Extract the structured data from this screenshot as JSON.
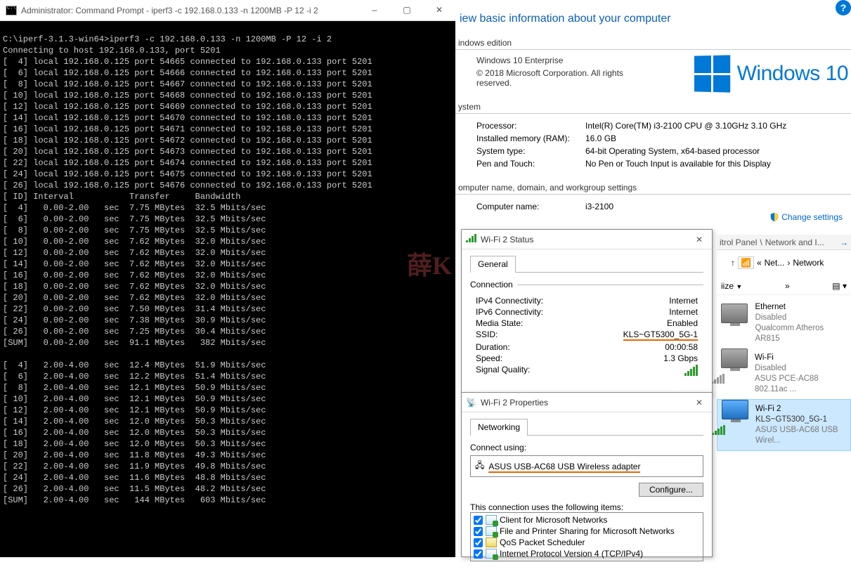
{
  "cmd": {
    "title": "Administrator: Command Prompt - iperf3  -c 192.168.0.133 -n 1200MB -P 12 -i 2",
    "prompt_prefix": "C:\\iperf-3.1.3-win64>",
    "command": "iperf3 -c 192.168.0.133 -n 1200MB -P 12 -i 2",
    "connecting": "Connecting to host 192.168.0.133, port 5201",
    "local_ip": "192.168.0.125",
    "remote_ip": "192.168.0.133",
    "remote_port": "5201",
    "connect_ids": [
      4,
      6,
      8,
      10,
      12,
      14,
      16,
      18,
      20,
      22,
      24,
      26
    ],
    "connect_start_port": 54665,
    "header": "[ ID] Interval           Transfer     Bandwidth",
    "interval1": "0.00-2.00",
    "interval2": "2.00-4.00",
    "block1": [
      {
        "id": 4,
        "xfer": "7.75 MBytes",
        "bw": "32.5 Mbits/sec"
      },
      {
        "id": 6,
        "xfer": "7.75 MBytes",
        "bw": "32.5 Mbits/sec"
      },
      {
        "id": 8,
        "xfer": "7.75 MBytes",
        "bw": "32.5 Mbits/sec"
      },
      {
        "id": 10,
        "xfer": "7.62 MBytes",
        "bw": "32.0 Mbits/sec"
      },
      {
        "id": 12,
        "xfer": "7.62 MBytes",
        "bw": "32.0 Mbits/sec"
      },
      {
        "id": 14,
        "xfer": "7.62 MBytes",
        "bw": "32.0 Mbits/sec"
      },
      {
        "id": 16,
        "xfer": "7.62 MBytes",
        "bw": "32.0 Mbits/sec"
      },
      {
        "id": 18,
        "xfer": "7.62 MBytes",
        "bw": "32.0 Mbits/sec"
      },
      {
        "id": 20,
        "xfer": "7.62 MBytes",
        "bw": "32.0 Mbits/sec"
      },
      {
        "id": 22,
        "xfer": "7.50 MBytes",
        "bw": "31.4 Mbits/sec"
      },
      {
        "id": 24,
        "xfer": "7.38 MBytes",
        "bw": "30.9 Mbits/sec"
      },
      {
        "id": 26,
        "xfer": "7.25 MBytes",
        "bw": "30.4 Mbits/sec"
      }
    ],
    "sum1": {
      "xfer": "91.1 MBytes",
      "bw": " 382 Mbits/sec"
    },
    "block2": [
      {
        "id": 4,
        "xfer": "12.4 MBytes",
        "bw": "51.9 Mbits/sec"
      },
      {
        "id": 6,
        "xfer": "12.2 MBytes",
        "bw": "51.4 Mbits/sec"
      },
      {
        "id": 8,
        "xfer": "12.1 MBytes",
        "bw": "50.9 Mbits/sec"
      },
      {
        "id": 10,
        "xfer": "12.1 MBytes",
        "bw": "50.9 Mbits/sec"
      },
      {
        "id": 12,
        "xfer": "12.1 MBytes",
        "bw": "50.9 Mbits/sec"
      },
      {
        "id": 14,
        "xfer": "12.0 MBytes",
        "bw": "50.3 Mbits/sec"
      },
      {
        "id": 16,
        "xfer": "12.0 MBytes",
        "bw": "50.3 Mbits/sec"
      },
      {
        "id": 18,
        "xfer": "12.0 MBytes",
        "bw": "50.3 Mbits/sec"
      },
      {
        "id": 20,
        "xfer": "11.8 MBytes",
        "bw": "49.3 Mbits/sec"
      },
      {
        "id": 22,
        "xfer": "11.9 MBytes",
        "bw": "49.8 Mbits/sec"
      },
      {
        "id": 24,
        "xfer": "11.6 MBytes",
        "bw": "48.8 Mbits/sec"
      },
      {
        "id": 26,
        "xfer": "11.5 MBytes",
        "bw": "48.2 Mbits/sec"
      }
    ],
    "sum2": {
      "xfer": " 144 MBytes",
      "bw": " 603 Mbits/sec"
    }
  },
  "system": {
    "heading": "iew basic information about your computer",
    "edition_label": "indows edition",
    "edition": "Windows 10 Enterprise",
    "copyright": "© 2018 Microsoft Corporation. All rights reserved.",
    "logo_text": "Windows 10",
    "system_label": "ystem",
    "processor_k": "Processor:",
    "processor_v": "Intel(R) Core(TM) i3-2100 CPU @ 3.10GHz   3.10 GHz",
    "ram_k": "Installed memory (RAM):",
    "ram_v": "16.0 GB",
    "type_k": "System type:",
    "type_v": "64-bit Operating System, x64-based processor",
    "pen_k": "Pen and Touch:",
    "pen_v": "No Pen or Touch Input is available for this Display",
    "cgroup_label": "omputer name, domain, and workgroup settings",
    "cname_k": "Computer name:",
    "cname_v": "i3-2100",
    "change_settings": "Change settings"
  },
  "status": {
    "title": "Wi-Fi 2 Status",
    "tab": "General",
    "section": "Connection",
    "ipv4_k": "IPv4 Connectivity:",
    "ipv4_v": "Internet",
    "ipv6_k": "IPv6 Connectivity:",
    "ipv6_v": "Internet",
    "media_k": "Media State:",
    "media_v": "Enabled",
    "ssid_k": "SSID:",
    "ssid_v": "KLS~GT5300_5G-1",
    "dur_k": "Duration:",
    "dur_v": "00:00:58",
    "speed_k": "Speed:",
    "speed_v": "1.3 Gbps",
    "sig_k": "Signal Quality:"
  },
  "props": {
    "title": "Wi-Fi 2 Properties",
    "tab": "Networking",
    "connect_using": "Connect using:",
    "adapter": "ASUS USB-AC68 USB Wireless adapter",
    "configure": "Configure...",
    "uses_items": "This connection uses the following items:",
    "items": [
      "Client for Microsoft Networks",
      "File and Printer Sharing for Microsoft Networks",
      "QoS Packet Scheduler",
      "Internet Protocol Version 4 (TCP/IPv4)"
    ]
  },
  "explorer": {
    "crumb1a": "itrol Panel",
    "crumb1b": "Network and I...",
    "nav_up": "↑",
    "crumb2a": "Net...",
    "crumb2b": "Network",
    "organize": "iize",
    "items": [
      {
        "name": "Ethernet",
        "line2": "Disabled",
        "line3": "Qualcomm Atheros AR815",
        "type": "eth_disabled"
      },
      {
        "name": "Wi-Fi",
        "line2": "Disabled",
        "line3": "ASUS PCE-AC88 802.11ac ...",
        "type": "wifi_disabled"
      },
      {
        "name": "Wi-Fi 2",
        "line2": "KLS~GT5300_5G-1",
        "line3": "ASUS USB-AC68 USB Wirel...",
        "type": "wifi_active",
        "selected": true
      }
    ]
  }
}
